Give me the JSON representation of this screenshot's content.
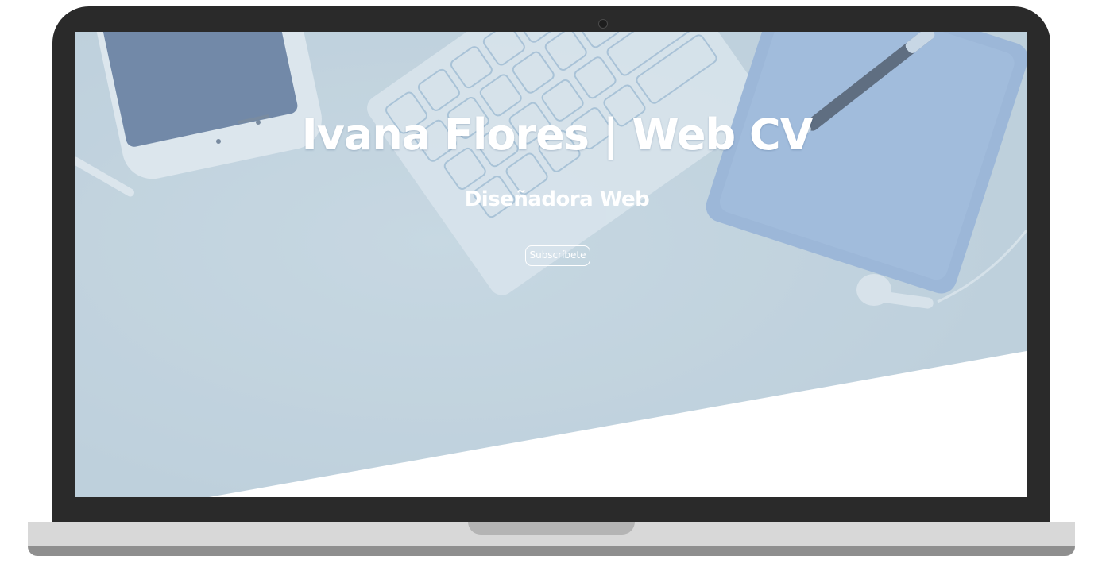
{
  "hero": {
    "title": "Ivana Flores | Web CV",
    "subtitle": "Diseñadora Web",
    "cta_label": "Subscríbete"
  },
  "colors": {
    "hero_overlay": "#c3d5df",
    "text": "#ffffff",
    "laptop_frame": "#2a2a2a",
    "laptop_base": "#d8d8d8"
  }
}
